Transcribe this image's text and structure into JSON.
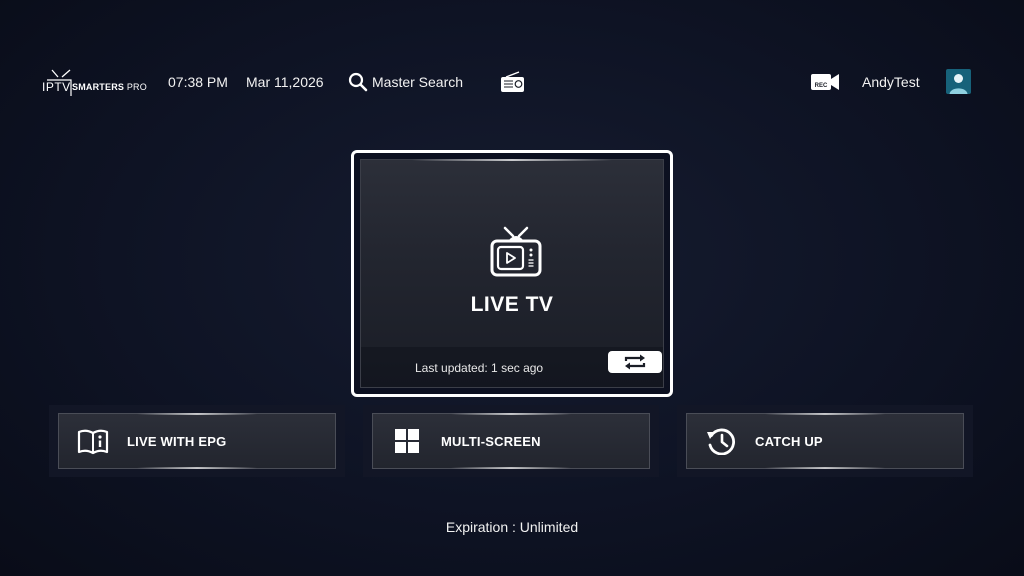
{
  "app": {
    "logo_iptv": "IPTV",
    "logo_smarters": "SMARTERS",
    "logo_pro": "PRO"
  },
  "header": {
    "time": "07:38 PM",
    "date": "Mar 11,2026",
    "search_label": "Master Search",
    "radio_icon": "radio-icon",
    "rec_icon": "rec-camera-icon",
    "rec_text": "REC",
    "user_name": "AndyTest",
    "avatar_icon": "user-avatar-icon"
  },
  "live_tv": {
    "title": "LIVE TV",
    "last_updated": "Last updated: 1 sec ago",
    "icon": "tv-icon",
    "refresh_icon": "refresh-icon"
  },
  "tiles": [
    {
      "label": "LIVE WITH EPG",
      "icon": "book-info-icon"
    },
    {
      "label": "MULTI-SCREEN",
      "icon": "grid-icon"
    },
    {
      "label": "CATCH UP",
      "icon": "history-clock-icon"
    }
  ],
  "footer": {
    "expiration": "Expiration : Unlimited"
  },
  "colors": {
    "background": "#0d1120",
    "card": "#2c2f39",
    "focus_border": "#ffffff",
    "avatar": "#17627a"
  }
}
